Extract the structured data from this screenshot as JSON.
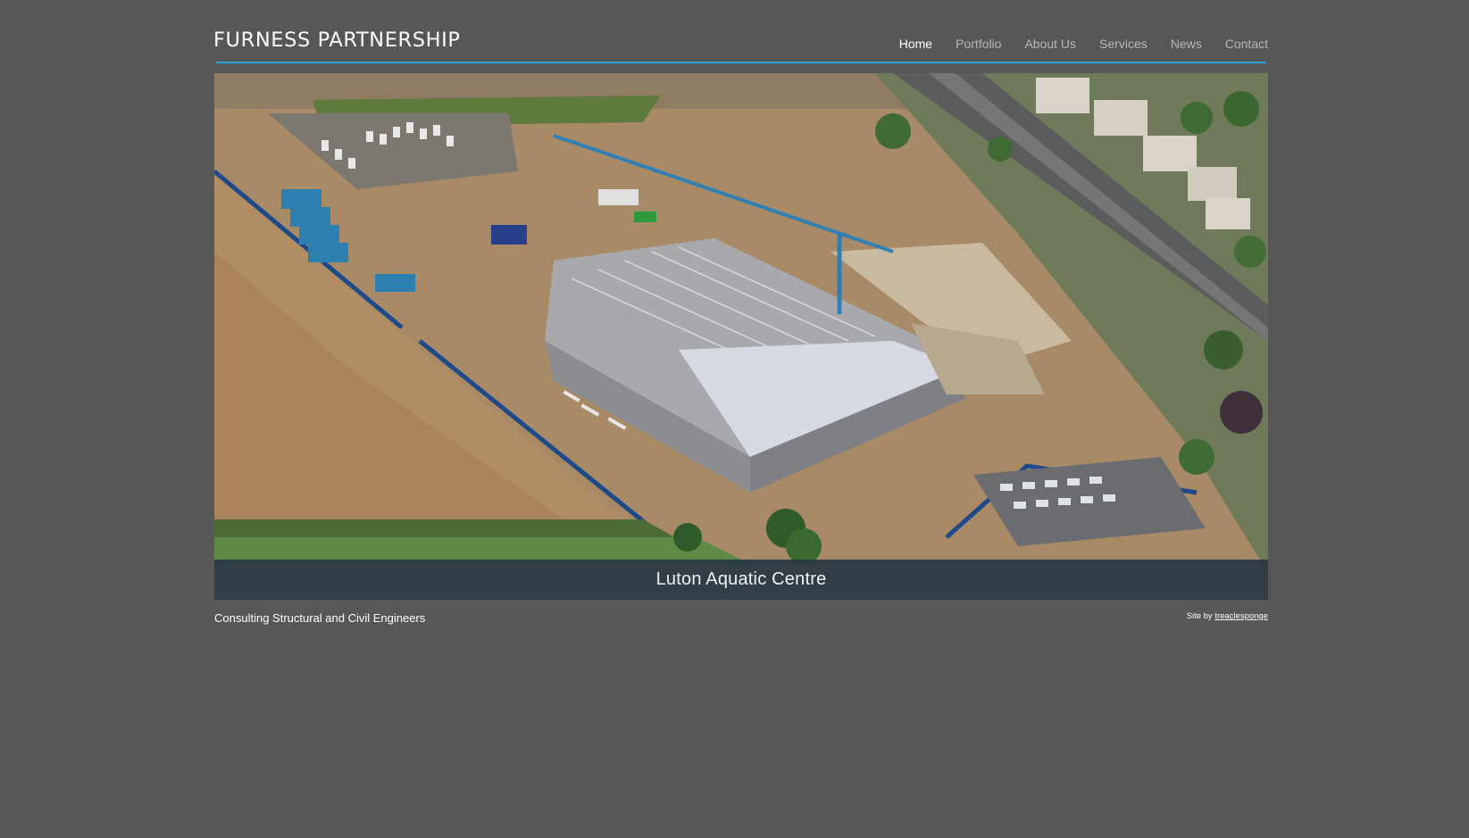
{
  "header": {
    "logo_text": "FURNESS PARTNERSHIP",
    "nav": [
      {
        "label": "Home",
        "active": true
      },
      {
        "label": "Portfolio",
        "active": false
      },
      {
        "label": "About Us",
        "active": false
      },
      {
        "label": "Services",
        "active": false
      },
      {
        "label": "News",
        "active": false
      },
      {
        "label": "Contact",
        "active": false
      }
    ]
  },
  "hero": {
    "caption": "Luton Aquatic Centre"
  },
  "footer": {
    "tagline": "Consulting Structural and Civil Engineers",
    "credit_prefix": "Site by",
    "credit_link": "treaclesponge"
  },
  "colors": {
    "background": "#575757",
    "accent_rule": "#2aa3d9",
    "caption_bar": "#283642",
    "nav_inactive": "#b8b8b8",
    "nav_active": "#ffffff"
  }
}
